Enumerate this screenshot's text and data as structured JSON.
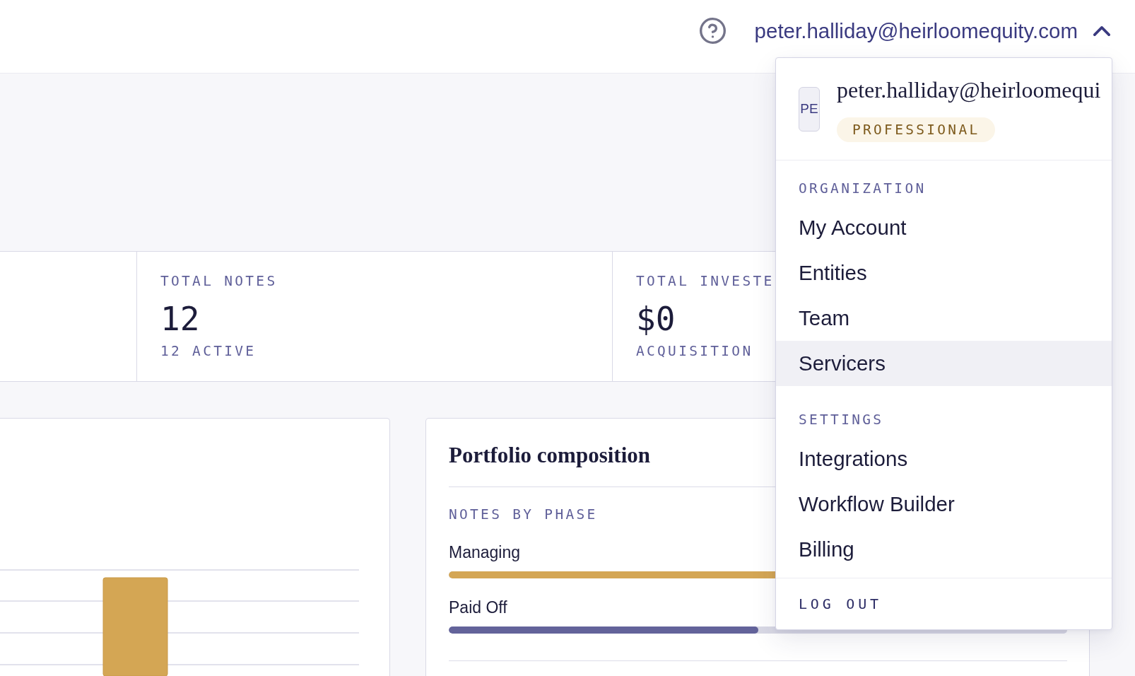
{
  "header": {
    "user_email": "peter.halliday@heirloomequity.com",
    "menu_expanded": true
  },
  "stats": [
    {
      "label": "TOTAL NOTES",
      "value": "12",
      "subtext": "12 ACTIVE"
    },
    {
      "label": "TOTAL INVESTE",
      "value": "$0",
      "subtext": "ACQUISITION"
    }
  ],
  "portfolio": {
    "title": "Portfolio composition",
    "section_label": "NOTES BY PHASE",
    "phases": [
      {
        "name": "Managing",
        "level": 1,
        "color": "#d4a654"
      },
      {
        "name": "Paid Off",
        "level": 0.5,
        "color": "#63639a"
      }
    ]
  },
  "user_menu": {
    "avatar": "PE",
    "email": "peter.halliday@heirloomequi",
    "plan": "PROFESSIONAL",
    "sections": [
      {
        "heading": "ORGANIZATION",
        "items": [
          {
            "label": "My Account",
            "selected": false
          },
          {
            "label": "Entities",
            "selected": false
          },
          {
            "label": "Team",
            "selected": false
          },
          {
            "label": "Servicers",
            "selected": true
          }
        ]
      },
      {
        "heading": "SETTINGS",
        "items": [
          {
            "label": "Integrations",
            "selected": false
          },
          {
            "label": "Workflow Builder",
            "selected": false
          },
          {
            "label": "Billing",
            "selected": false
          }
        ]
      }
    ],
    "logout": "LOG OUT"
  }
}
